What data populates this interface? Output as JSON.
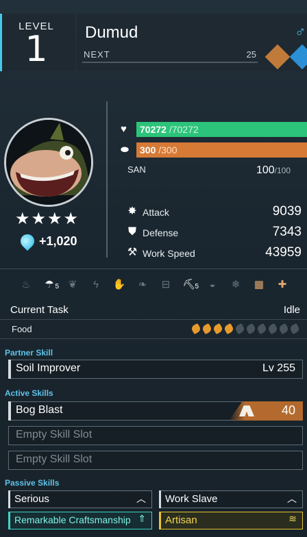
{
  "header": {
    "level_label": "LEVEL",
    "level": "1",
    "name": "Dumud",
    "next_label": "NEXT",
    "next_value": "25",
    "gender_icon": "male-icon",
    "elements": [
      {
        "name": "ground-element-icon",
        "color": "#c07a3a"
      },
      {
        "name": "water-element-icon",
        "color": "#2b8fd6"
      }
    ]
  },
  "portrait": {
    "stars": "★★★★",
    "soul_bonus": "+1,020"
  },
  "vitals": {
    "hp_current": "70272",
    "hp_max": " /70272",
    "sp_current": "300",
    "sp_max": " /300",
    "san_label": "SAN",
    "san_current": "100",
    "san_max": "/100"
  },
  "stats": [
    {
      "icon": "attack-icon",
      "label": "Attack",
      "value": "9039"
    },
    {
      "icon": "defense-icon",
      "label": "Defense",
      "value": "7343"
    },
    {
      "icon": "work-speed-icon",
      "label": "Work Speed",
      "value": "43959"
    }
  ],
  "work_suitability": [
    {
      "icon": "kindling-icon",
      "active": false,
      "level": ""
    },
    {
      "icon": "watering-icon",
      "active": true,
      "level": "5"
    },
    {
      "icon": "planting-icon",
      "active": false,
      "level": ""
    },
    {
      "icon": "electricity-icon",
      "active": false,
      "level": ""
    },
    {
      "icon": "handiwork-icon",
      "active": false,
      "level": ""
    },
    {
      "icon": "gathering-icon",
      "active": false,
      "level": ""
    },
    {
      "icon": "lumbering-icon",
      "active": false,
      "level": ""
    },
    {
      "icon": "mining-icon",
      "active": true,
      "level": "5"
    },
    {
      "icon": "medicine-icon",
      "active": false,
      "level": ""
    },
    {
      "icon": "cooling-icon",
      "active": false,
      "level": ""
    },
    {
      "icon": "transporting-icon",
      "active": true,
      "level": ""
    },
    {
      "icon": "farming-icon",
      "active": true,
      "level": ""
    }
  ],
  "task": {
    "label": "Current Task",
    "value": "Idle"
  },
  "food": {
    "label": "Food",
    "filled": 4,
    "total": 10,
    "full_color": "#e69a2c"
  },
  "partner_skill": {
    "title": "Partner Skill",
    "name": "Soil Improver",
    "level": "Lv  255"
  },
  "active_skills": {
    "title": "Active Skills",
    "slots": [
      {
        "name": "Bog Blast",
        "power": "40",
        "element_icon": "ground-element-icon"
      },
      {
        "name": "Empty Skill Slot"
      },
      {
        "name": "Empty Skill Slot"
      }
    ]
  },
  "passive_skills": {
    "title": "Passive Skills",
    "items": [
      {
        "name": "Serious",
        "rank_icon": "rank-1-icon",
        "tier": "normal"
      },
      {
        "name": "Work Slave",
        "rank_icon": "rank-1-icon",
        "tier": "normal"
      },
      {
        "name": "Remarkable Craftsmanship",
        "rank_icon": "rank-4-icon",
        "tier": "rare",
        "color": "#3fd6c6"
      },
      {
        "name": "Artisan",
        "rank_icon": "rank-3-icon",
        "tier": "gold",
        "color": "#e6c637"
      }
    ]
  }
}
